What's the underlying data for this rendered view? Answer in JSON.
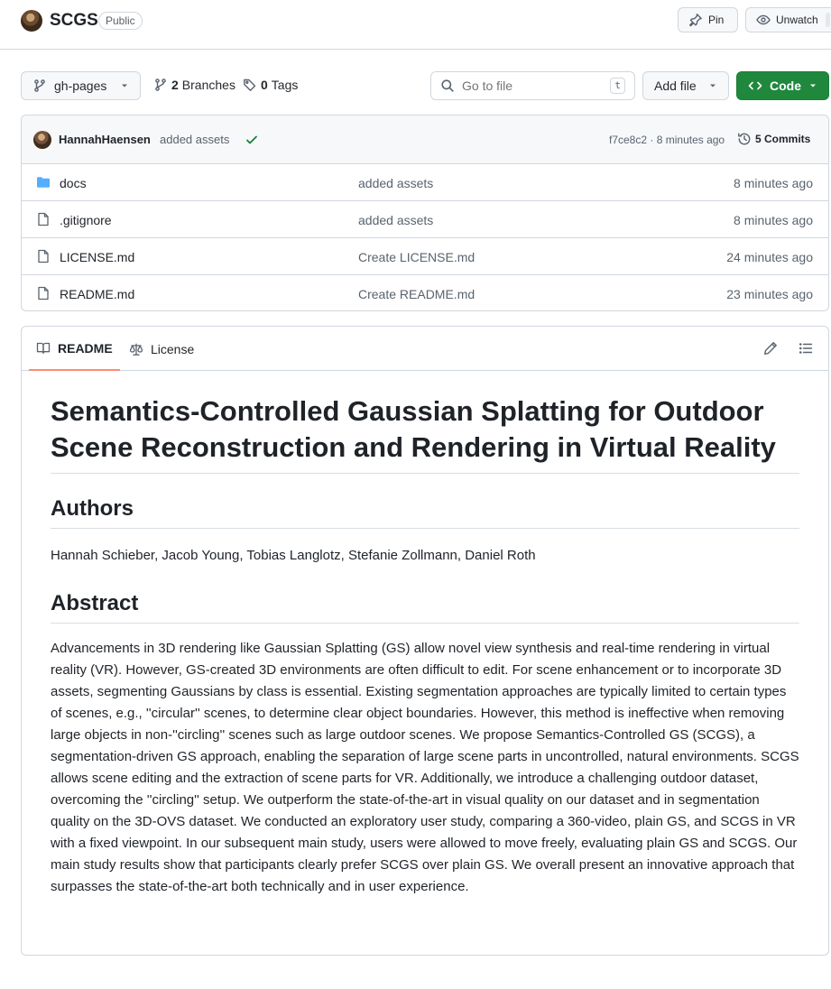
{
  "repo": {
    "name": "SCGS",
    "visibility": "Public",
    "pin_label": "Pin",
    "unwatch_label": "Unwatch"
  },
  "toolbar": {
    "branch": "gh-pages",
    "branches_count": "2",
    "branches_label": "Branches",
    "tags_count": "0",
    "tags_label": "Tags",
    "search_placeholder": "Go to file",
    "search_shortcut": "t",
    "add_file_label": "Add file",
    "code_label": "Code"
  },
  "colors": {
    "code_button": "#1f883d",
    "folder_icon": "#54aeff",
    "check": "#1a7f37",
    "tab_underline": "#fd8c73"
  },
  "latest_commit": {
    "author": "HannahHaensen",
    "message": "added assets",
    "hash": "f7ce8c2",
    "time": "8 minutes ago",
    "commits_label": "5 Commits"
  },
  "files": [
    {
      "name": "docs",
      "type": "folder",
      "commit": "added assets",
      "time": "8 minutes ago"
    },
    {
      "name": ".gitignore",
      "type": "file",
      "commit": "added assets",
      "time": "8 minutes ago"
    },
    {
      "name": "LICENSE.md",
      "type": "file",
      "commit": "Create LICENSE.md",
      "time": "24 minutes ago"
    },
    {
      "name": "README.md",
      "type": "file",
      "commit": "Create README.md",
      "time": "23 minutes ago"
    }
  ],
  "readme": {
    "tab_readme": "README",
    "tab_license": "License",
    "title": "Semantics-Controlled Gaussian Splatting for Outdoor Scene Reconstruction and Rendering in Virtual Reality",
    "authors_heading": "Authors",
    "authors": "Hannah Schieber, Jacob Young, Tobias Langlotz, Stefanie Zollmann, Daniel Roth",
    "abstract_heading": "Abstract",
    "abstract": "Advancements in 3D rendering like Gaussian Splatting (GS) allow novel view synthesis and real-time rendering in virtual reality (VR). However, GS-created 3D environments are often difficult to edit. For scene enhancement or to incorporate 3D assets, segmenting Gaussians by class is essential. Existing segmentation approaches are typically limited to certain types of scenes, e.g., ''circular'' scenes, to determine clear object boundaries. However, this method is ineffective when removing large objects in non-''circling'' scenes such as large outdoor scenes. We propose Semantics-Controlled GS (SCGS), a segmentation-driven GS approach, enabling the separation of large scene parts in uncontrolled, natural environments. SCGS allows scene editing and the extraction of scene parts for VR. Additionally, we introduce a challenging outdoor dataset, overcoming the ''circling'' setup. We outperform the state-of-the-art in visual quality on our dataset and in segmentation quality on the 3D-OVS dataset. We conducted an exploratory user study, comparing a 360-video, plain GS, and SCGS in VR with a fixed viewpoint. In our subsequent main study, users were allowed to move freely, evaluating plain GS and SCGS. Our main study results show that participants clearly prefer SCGS over plain GS. We overall present an innovative approach that surpasses the state-of-the-art both technically and in user experience."
  }
}
